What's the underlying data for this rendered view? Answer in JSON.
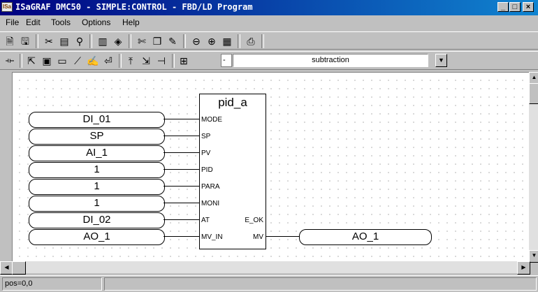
{
  "window": {
    "title": "ISaGRAF DMC50 - SIMPLE:CONTROL - FBD/LD Program",
    "icon": "isagraf-app-icon",
    "controls": {
      "minimize": "_",
      "maximize": "□",
      "close": "×"
    }
  },
  "menu": [
    "File",
    "Edit",
    "Tools",
    "Options",
    "Help"
  ],
  "toolbar1": {
    "icons": [
      "new-file-icon",
      "save-icon",
      "cut-icon",
      "paste-icon",
      "variable-icon",
      "dictionary-icon",
      "verify-icon",
      "scissors-icon",
      "copy-icon",
      "edit-icon",
      "zoom-out-icon",
      "zoom-in-icon",
      "grid-icon",
      "print-icon"
    ]
  },
  "toolbar2": {
    "icons": [
      "contact-icon",
      "select-arrow-icon",
      "block-icon",
      "variable-box-icon",
      "connection-icon",
      "comment-icon",
      "return-icon",
      "jump-icon",
      "label-icon",
      "corner-icon",
      "function-block-icon"
    ],
    "field_value": "-",
    "combo_value": "subtraction"
  },
  "diagram": {
    "block_name": "pid_a",
    "inputs": [
      {
        "pin": "MODE",
        "variable": "DI_01"
      },
      {
        "pin": "SP",
        "variable": "SP"
      },
      {
        "pin": "PV",
        "variable": "AI_1"
      },
      {
        "pin": "PID",
        "variable": "1"
      },
      {
        "pin": "PARA",
        "variable": "1"
      },
      {
        "pin": "MONI",
        "variable": "1"
      },
      {
        "pin": "AT",
        "variable": "DI_02"
      },
      {
        "pin": "MV_IN",
        "variable": "AO_1"
      }
    ],
    "outputs": [
      {
        "pin": "E_OK",
        "variable": ""
      },
      {
        "pin": "MV",
        "variable": "AO_1"
      }
    ]
  },
  "status": {
    "position": "pos=0,0"
  }
}
